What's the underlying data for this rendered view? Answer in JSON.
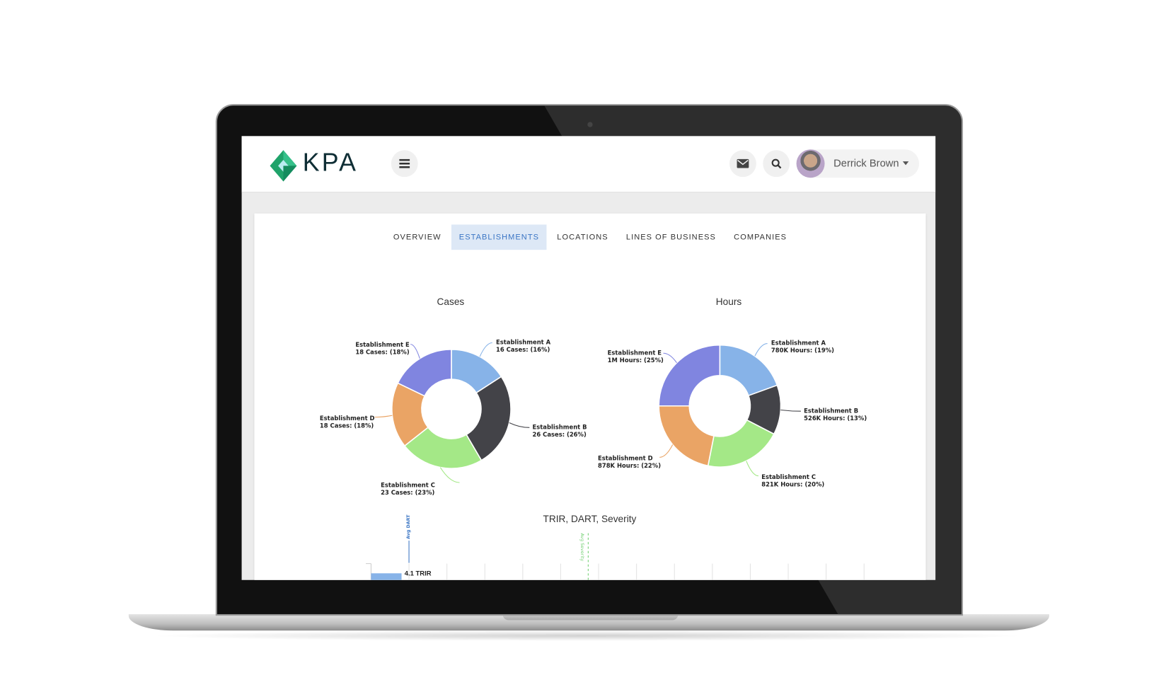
{
  "header": {
    "logo_text": "KPA",
    "menu_icon": "hamburger-icon",
    "mail_icon": "envelope-icon",
    "search_icon": "search-icon",
    "user_name": "Derrick Brown"
  },
  "tabs": [
    {
      "label": "OVERVIEW",
      "active": false
    },
    {
      "label": "ESTABLISHMENTS",
      "active": true
    },
    {
      "label": "LOCATIONS",
      "active": false
    },
    {
      "label": "LINES OF BUSINESS",
      "active": false
    },
    {
      "label": "COMPANIES",
      "active": false
    }
  ],
  "colors": {
    "A": "#87b3e8",
    "B": "#434348",
    "C": "#a4e887",
    "D": "#eaa465",
    "E": "#8085e0",
    "accent": "#3a75c4"
  },
  "chart_data": [
    {
      "type": "pie",
      "title": "Cases",
      "categories": [
        "Establishment A",
        "Establishment B",
        "Establishment C",
        "Establishment D",
        "Establishment E"
      ],
      "values": [
        16,
        26,
        23,
        18,
        18
      ],
      "labels": [
        "16 Cases: (16%)",
        "26 Cases: (26%)",
        "23 Cases: (23%)",
        "18 Cases: (18%)",
        "18 Cases: (18%)"
      ]
    },
    {
      "type": "pie",
      "title": "Hours",
      "categories": [
        "Establishment A",
        "Establishment B",
        "Establishment C",
        "Establishment D",
        "Establishment E"
      ],
      "values": [
        780000,
        526000,
        821000,
        878000,
        1000000
      ],
      "labels": [
        "780K Hours: (19%)",
        "526K Hours: (13%)",
        "821K Hours: (20%)",
        "878K Hours: (22%)",
        "1M Hours: (25%)"
      ]
    },
    {
      "type": "bar",
      "title": "TRIR, DART, Severity",
      "bar_labels": [
        "4.1 TRIR"
      ],
      "values": [
        4.1
      ],
      "plot_lines": [
        {
          "label": "Avg DART",
          "color": "#3a75c4"
        },
        {
          "label": "Avg Severity",
          "color": "#6fcf6f"
        }
      ],
      "grid": true
    }
  ]
}
